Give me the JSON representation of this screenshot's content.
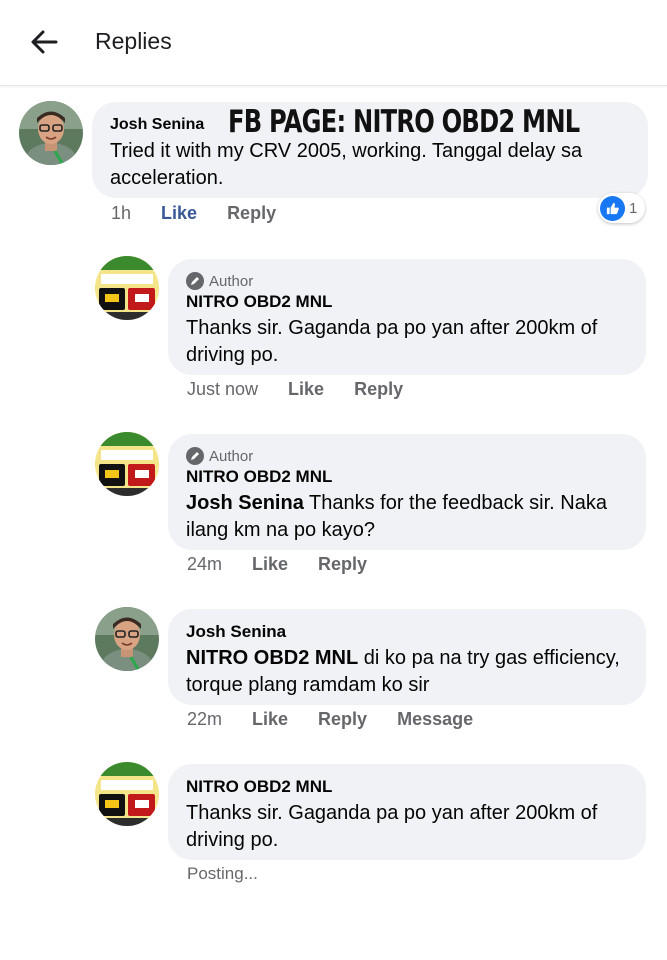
{
  "header": {
    "title": "Replies"
  },
  "overlay": {
    "title": "FB PAGE: NITRO OBD2 MNL"
  },
  "comments": [
    {
      "author": "Josh Senina",
      "text": "Tried it with my CRV 2005, working. Tanggal delay sa acceleration.",
      "time": "1h",
      "like": "Like",
      "reply": "Reply",
      "reaction_count": "1"
    },
    {
      "badge": "Author",
      "author": "NITRO OBD2 MNL",
      "text": "Thanks sir. Gaganda pa po yan after 200km of driving po.",
      "time": "Just now",
      "like": "Like",
      "reply": "Reply"
    },
    {
      "badge": "Author",
      "author": "NITRO OBD2 MNL",
      "mention": "Josh Senina",
      "text": " Thanks for the feedback sir. Naka ilang km na po kayo?",
      "time": "24m",
      "like": "Like",
      "reply": "Reply"
    },
    {
      "author": "Josh Senina",
      "mention": "NITRO OBD2 MNL",
      "text": " di ko pa na try gas efficiency, torque plang ramdam ko sir",
      "time": "22m",
      "like": "Like",
      "reply": "Reply",
      "message": "Message"
    },
    {
      "author": "NITRO OBD2 MNL",
      "text": "Thanks sir. Gaganda pa po yan after 200km of driving po.",
      "status": "Posting..."
    }
  ]
}
